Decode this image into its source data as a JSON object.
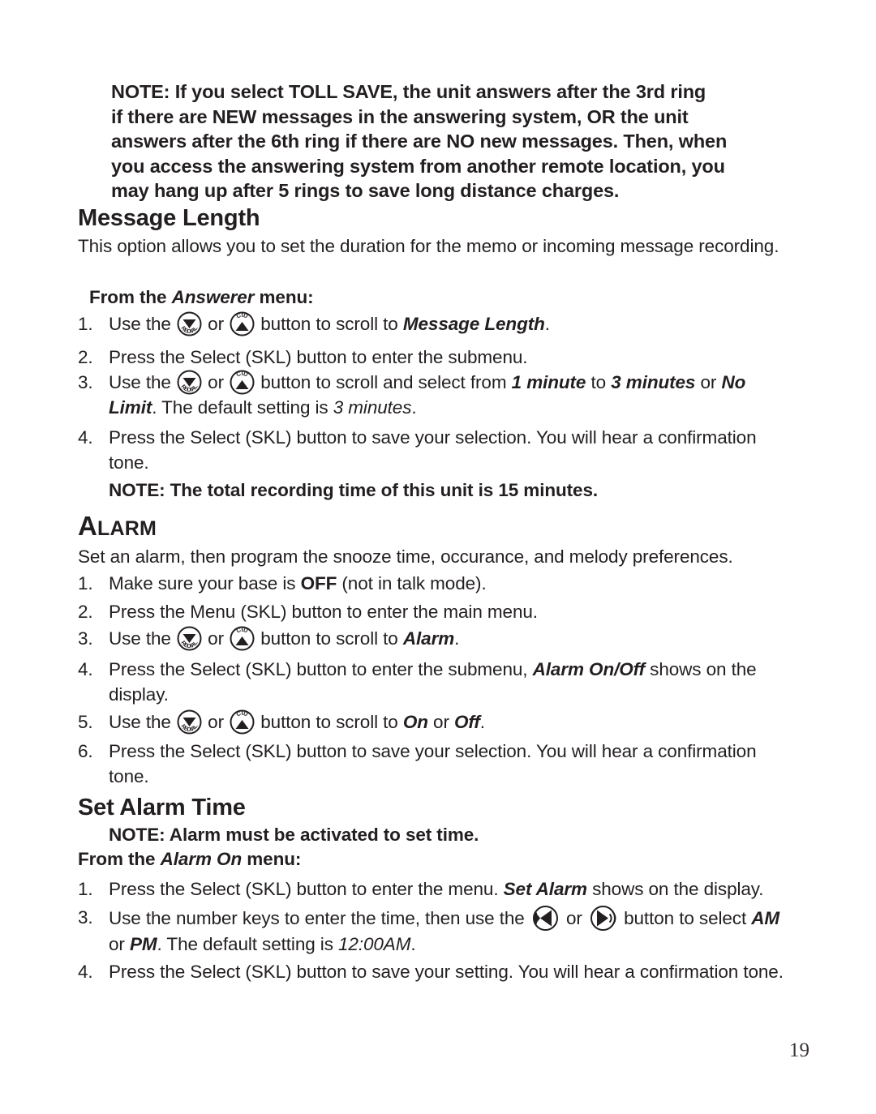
{
  "document": {
    "page_number": "19",
    "text_color": "#231f20"
  },
  "top_note": {
    "line1": "NOTE: If you select TOLL SAVE, the unit answers after the 3rd ring",
    "line2": "if there are NEW messages in the answering system, OR the unit",
    "line3": "answers after the 6th ring if there are NO new messages. Then, when",
    "line4": "you access the answering system from another remote location, you",
    "line5": "may hang up after 5 rings to save long distance charges."
  },
  "message_length": {
    "heading": "Message Length",
    "intro": "This option allows you to set the duration for the memo or incoming message recording.",
    "from_menu_prefix": "From the ",
    "from_menu_italic": "Answerer",
    "from_menu_suffix": " menu:",
    "items": [
      {
        "num": "1.",
        "part1": "Use the ",
        "icon1": "redial-down-button-icon",
        "mid": " or ",
        "icon2": "cid-up-button-icon",
        "part2": " button to scroll to ",
        "emph": "Message Length",
        "part3": "."
      },
      {
        "num": "2.",
        "text": "Press the Select (SKL) button to enter the submenu."
      },
      {
        "num": "3.",
        "part1": "Use the ",
        "icon1": "redial-down-button-icon",
        "mid": " or ",
        "icon2": "cid-up-button-icon",
        "part2": " button to scroll and select from ",
        "emph1": "1 minute",
        "part3": " to ",
        "emph2": "3 minutes",
        "part4": " or ",
        "emph3": "No Limit",
        "part5": ". The default setting is ",
        "emph4": "3 minutes",
        "part6": "."
      },
      {
        "num": "4.",
        "text": "Press the Select (SKL) button to save your selection. You will hear a confirmation tone."
      }
    ],
    "note": "NOTE: The total recording time of this unit is 15 minutes."
  },
  "alarm": {
    "heading_cap": "A",
    "heading_rest": "LARM",
    "intro": "Set an alarm, then program the snooze time, occurance, and melody preferences.",
    "items": [
      {
        "num": "1.",
        "part1": "Make sure your base is ",
        "emph": "OFF",
        "part2": " (not in talk mode)."
      },
      {
        "num": "2.",
        "text": "Press the Menu (SKL) button to enter the main menu."
      },
      {
        "num": "3.",
        "part1": "Use the ",
        "icon1": "redial-down-button-icon",
        "mid": " or ",
        "icon2": "cid-up-button-icon",
        "part2": " button to scroll to ",
        "emph": "Alarm",
        "part3": "."
      },
      {
        "num": "4.",
        "part1": "Press the Select (SKL) button to enter the submenu, ",
        "emph": "Alarm On/Off",
        "part2": " shows on the display."
      },
      {
        "num": "5.",
        "part1": "Use the ",
        "icon1": "redial-down-button-icon",
        "mid": " or ",
        "icon2": "cid-up-button-icon",
        "part2": " button to scroll to ",
        "emph1": "On",
        "part3": " or ",
        "emph2": "Off",
        "part4": "."
      },
      {
        "num": "6.",
        "text": "Press the Select (SKL) button to save your selection. You will hear a confirmation tone."
      }
    ]
  },
  "set_alarm_time": {
    "heading": "Set Alarm Time",
    "note": "NOTE: Alarm must be activated to set time.",
    "from_menu_prefix": "From the ",
    "from_menu_italic": "Alarm On",
    "from_menu_suffix": " menu:",
    "items": [
      {
        "num": "1.",
        "part1": "Press the Select (SKL) button to enter the menu. ",
        "emph": "Set Alarm",
        "part2": " shows on the display."
      },
      {
        "num": "3.",
        "part1": "Use the number keys to enter the time, then use the ",
        "icon1": "rewind-button-icon",
        "mid": " or ",
        "icon2": "play-forward-button-icon",
        "part2": " button to select ",
        "emph1": "AM",
        "part3": " or ",
        "emph2": "PM",
        "part4": ". The default setting is ",
        "emph3": "12:00AM",
        "part5": "."
      },
      {
        "num": "4.",
        "text": "Press the Select (SKL) button to save your setting. You will hear a confirmation tone."
      }
    ]
  }
}
